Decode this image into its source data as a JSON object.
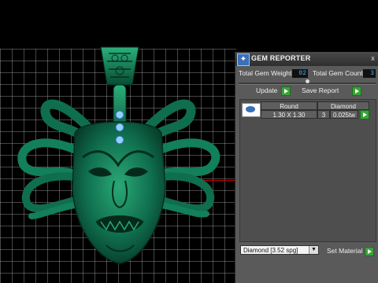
{
  "panel": {
    "title": "GEM REPORTER",
    "icon": "gem-reporter-app-icon",
    "close_label": "x",
    "total_gem_weight_label": "Total Gem Weight",
    "total_gem_weight_value": "02",
    "total_gem_count_label": "Total Gem Count",
    "total_gem_count_value": "3",
    "update_label": "Update",
    "save_report_label": "Save Report",
    "gem_table": {
      "columns": [
        "Round",
        "Diamond"
      ],
      "rows": [
        {
          "shape": "Round",
          "size": "1.30 X 1.30",
          "count": "3",
          "weight": "0.025tw",
          "material": "Diamond"
        }
      ]
    },
    "material_select": "Diamond     [3.52 spg]",
    "set_material_label": "Set Material"
  },
  "colors": {
    "model": "#0f6e4e",
    "panel_bg": "#5a5a5a",
    "value_text": "#4fb3ff",
    "accent_green": "#3aa33a"
  }
}
